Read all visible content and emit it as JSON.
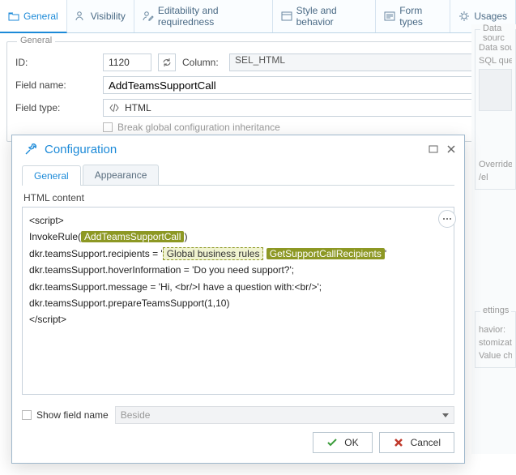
{
  "tabs": {
    "general": "General",
    "visibility": "Visibility",
    "editability": "Editability and requiredness",
    "style": "Style and behavior",
    "formtypes": "Form types",
    "usages": "Usages"
  },
  "group": {
    "legend": "General",
    "id_label": "ID:",
    "id_value": "1120",
    "column_label": "Column:",
    "column_value": "SEL_HTML",
    "fieldname_label": "Field name:",
    "fieldname_value": "AddTeamsSupportCall",
    "fieldtype_label": "Field type:",
    "fieldtype_value": "HTML",
    "inherit_label": "Break global configuration inheritance"
  },
  "side": {
    "datasource_legend": "Data sourc",
    "datasource_label": "Data source:",
    "sqlquery_label": "SQL query:",
    "override_label": "Override s",
    "vel": "/el",
    "settings_legend": "ettings",
    "havior": "havior:",
    "stomization": "stomization",
    "valuecha": "Value cha"
  },
  "modal": {
    "title": "Configuration",
    "tab_general": "General",
    "tab_appearance": "Appearance",
    "content_label": "HTML content",
    "lines": {
      "l1": "<script>",
      "l2a": "InvokeRule(",
      "l2b": "AddTeamsSupportCall",
      "l2c": ")",
      "l3a": "dkr.teamsSupport.recipients = '",
      "l3b": "Global business rules",
      "l3c": "GetSupportCallRecipients",
      "l3d": "'",
      "l4": "dkr.teamsSupport.hoverInformation = 'Do you need support?';",
      "l5": "dkr.teamsSupport.message = 'Hi, <br/>I have a question with:<br/>';",
      "l6": "dkr.teamsSupport.prepareTeamsSupport(1,10)",
      "l7": "</script>"
    },
    "show_fieldname": "Show field name",
    "beside": "Beside",
    "ok": "OK",
    "cancel": "Cancel"
  }
}
